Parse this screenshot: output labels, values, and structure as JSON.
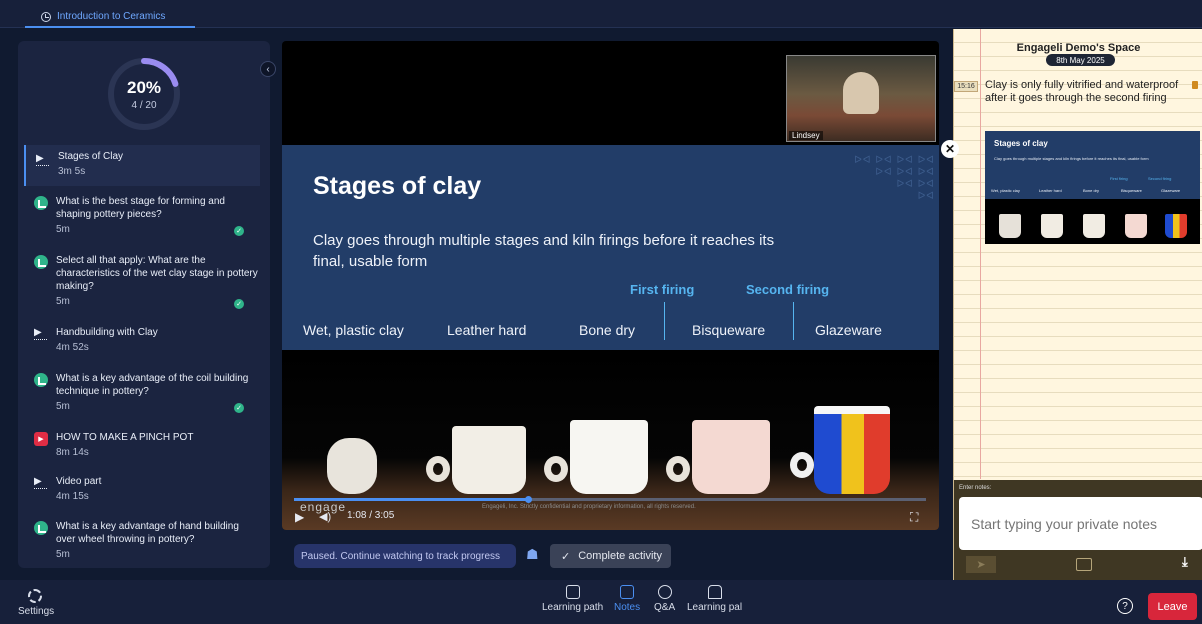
{
  "tab": {
    "label": "Introduction to Ceramics"
  },
  "progress": {
    "percent": "20%",
    "count": "4 / 20",
    "fraction": 0.2
  },
  "items": [
    {
      "title": "Stages of Clay",
      "duration": "3m 5s",
      "icon": "play-icon",
      "done": false,
      "active": true
    },
    {
      "title": "What is the best stage for forming and shaping pottery pieces?",
      "duration": "5m",
      "icon": "poll-icon",
      "done": true
    },
    {
      "title": "Select all that apply: What are the characteristics of the wet clay stage in pottery making?",
      "duration": "5m",
      "icon": "poll-icon",
      "done": true
    },
    {
      "title": "Handbuilding with Clay",
      "duration": "4m 52s",
      "icon": "play-icon",
      "done": false
    },
    {
      "title": "What is a key advantage of the coil building technique in pottery?",
      "duration": "5m",
      "icon": "poll-icon",
      "done": true
    },
    {
      "title": "HOW TO MAKE A PINCH POT",
      "duration": "8m 14s",
      "icon": "youtube-icon",
      "done": false
    },
    {
      "title": "Video part",
      "duration": "4m 15s",
      "icon": "play-icon",
      "done": false
    },
    {
      "title": "What is a key advantage of hand building over wheel throwing in pottery?",
      "duration": "5m",
      "icon": "poll-icon",
      "done": false
    }
  ],
  "video": {
    "slide_title": "Stages of clay",
    "slide_subtitle": "Clay goes through multiple stages and kiln firings before it reaches its final, usable form",
    "first_firing": "First firing",
    "second_firing": "Second firing",
    "stages": [
      "Wet, plastic clay",
      "Leather hard",
      "Bone dry",
      "Bisqueware",
      "Glazeware"
    ],
    "webcam_name": "Lindsey",
    "time": "1:08 / 3:05",
    "played_fraction": 0.37,
    "brand": "engage",
    "watermark": "Engageli, Inc. Strictly confidential and proprietary information, all rights reserved."
  },
  "status_text": "Paused. Continue watching to track progress",
  "complete_label": "Complete activity",
  "notes": {
    "space_title": "Engageli Demo's Space",
    "date": "8th May 2025",
    "note_time": "15:16",
    "note_text": "Clay is only fully vitrified and waterproof after it goes through the second firing",
    "thumb_title": "Stages of clay",
    "thumb_sub": "Clay goes through multiple stages and kiln firings before it reaches its final, usable form",
    "thumb_first": "First firing",
    "thumb_second": "Second firing",
    "enter_label": "Enter notes:",
    "placeholder": "Start typing your private notes"
  },
  "bottom": {
    "settings": "Settings",
    "learning_path": "Learning path",
    "notes": "Notes",
    "qa": "Q&A",
    "learning_pal": "Learning pal",
    "help": "?",
    "leave": "Leave"
  },
  "colors": {
    "accent": "#4b8ff1",
    "success": "#2fb48a",
    "danger": "#d8263b",
    "slide_bg": "#223d68",
    "firing": "#56b5f0"
  }
}
